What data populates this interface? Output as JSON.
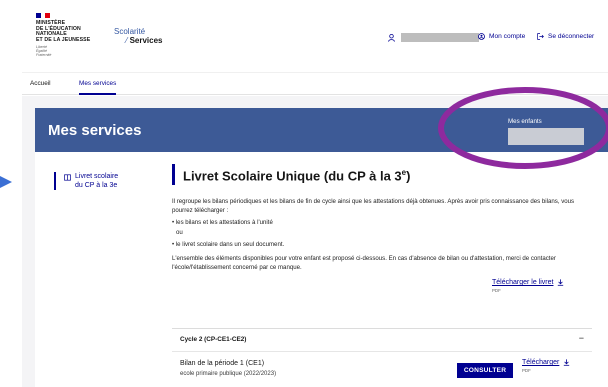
{
  "header": {
    "ministry_lines": [
      "MINISTÈRE",
      "DE L'ÉDUCATION",
      "NATIONALE",
      "ET DE LA JEUNESSE"
    ],
    "devise_lines": [
      "Liberté",
      "Égalité",
      "Fraternité"
    ],
    "brand_line1": "Scolarité",
    "brand_line2": "Services",
    "account_label": "Mon compte",
    "logout_label": "Se déconnecter"
  },
  "tabs": [
    {
      "label": "Accueil",
      "active": false
    },
    {
      "label": "Mes services",
      "active": true
    }
  ],
  "banner": {
    "title": "Mes services",
    "children_label": "Mes enfants"
  },
  "side_nav": {
    "label_line1": "Livret scolaire",
    "label_line2": "du CP à la 3e"
  },
  "content": {
    "title": "Livret Scolaire Unique (du CP à la 3",
    "title_sup": "e",
    "title_end": ")",
    "intro": "Il regroupe les bilans périodiques et les bilans de fin de cycle ainsi que les attestations déjà obtenues. Après avoir pris connaissance des bilans, vous pourrez télécharger :",
    "bullet1": "• les bilans et les attestations à l'unité",
    "or_label": "ou",
    "bullet2": "• le livret scolaire dans un seul document.",
    "info": "L'ensemble des éléments disponibles pour votre enfant est proposé ci-dessous. En cas d'absence de bilan ou d'attestation, merci de contacter l'école/l'établissement concerné par ce manque.",
    "download_booklet_label": "Télécharger le livret",
    "download_booklet_format": "PDF"
  },
  "cycle": {
    "title": "Cycle 2 (CP-CE1-CE2)",
    "toggle": "−",
    "period_title": "Bilan de la période 1 (CE1)",
    "period_school": "ecole primaire publique (2022/2023)",
    "consult_label": "CONSULTER",
    "download_label": "Télécharger",
    "download_format": "PDF"
  },
  "colors": {
    "primary_blue": "#000091",
    "banner_blue": "#3d5a96",
    "highlight_purple": "#8e2a9e",
    "flag_blue": "#000091",
    "flag_red": "#e1000f"
  }
}
